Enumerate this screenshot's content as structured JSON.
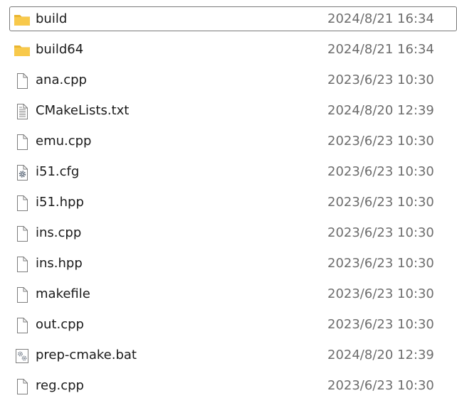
{
  "files": [
    {
      "name": "build",
      "date": "2024/8/21 16:34",
      "icon": "folder-icon",
      "selected": true
    },
    {
      "name": "build64",
      "date": "2024/8/21 16:34",
      "icon": "folder-icon",
      "selected": false
    },
    {
      "name": "ana.cpp",
      "date": "2023/6/23 10:30",
      "icon": "file-icon",
      "selected": false
    },
    {
      "name": "CMakeLists.txt",
      "date": "2024/8/20 12:39",
      "icon": "text-file-icon",
      "selected": false
    },
    {
      "name": "emu.cpp",
      "date": "2023/6/23 10:30",
      "icon": "file-icon",
      "selected": false
    },
    {
      "name": "i51.cfg",
      "date": "2023/6/23 10:30",
      "icon": "config-file-icon",
      "selected": false
    },
    {
      "name": "i51.hpp",
      "date": "2023/6/23 10:30",
      "icon": "file-icon",
      "selected": false
    },
    {
      "name": "ins.cpp",
      "date": "2023/6/23 10:30",
      "icon": "file-icon",
      "selected": false
    },
    {
      "name": "ins.hpp",
      "date": "2023/6/23 10:30",
      "icon": "file-icon",
      "selected": false
    },
    {
      "name": "makefile",
      "date": "2023/6/23 10:30",
      "icon": "file-icon",
      "selected": false
    },
    {
      "name": "out.cpp",
      "date": "2023/6/23 10:30",
      "icon": "file-icon",
      "selected": false
    },
    {
      "name": "prep-cmake.bat",
      "date": "2024/8/20 12:39",
      "icon": "batch-file-icon",
      "selected": false
    },
    {
      "name": "reg.cpp",
      "date": "2023/6/23 10:30",
      "icon": "file-icon",
      "selected": false
    }
  ],
  "colors": {
    "folder": "#f8c94b",
    "folder_tab": "#e9b530",
    "selection_border": "#7a7a7a",
    "date_text": "#6d6d6d"
  }
}
